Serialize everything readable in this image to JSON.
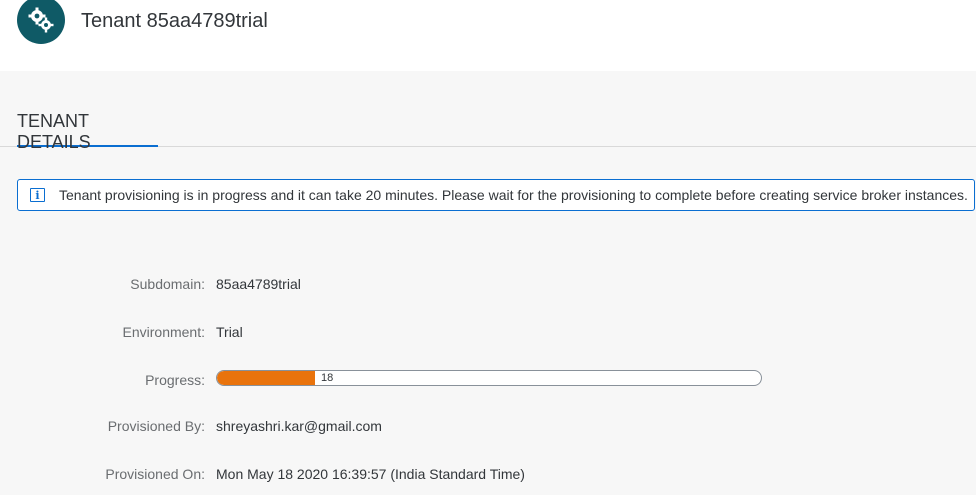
{
  "header": {
    "icon": "gears-icon",
    "title": "Tenant 85aa4789trial",
    "avatar_color": "#0f5a66"
  },
  "tabs": [
    {
      "label": "TENANT DETAILS",
      "selected": true
    }
  ],
  "message": {
    "icon": "info-icon",
    "text": "Tenant provisioning is in progress and it can take 20 minutes. Please wait for the provisioning to complete before creating service broker instances."
  },
  "details": {
    "subdomain": {
      "label": "Subdomain:",
      "value": "85aa4789trial"
    },
    "environment": {
      "label": "Environment:",
      "value": "Trial"
    },
    "progress": {
      "label": "Progress:",
      "value": 18,
      "value_text": "18",
      "max": 100,
      "color": "#e9730c"
    },
    "provisioned_by": {
      "label": "Provisioned By:",
      "value": "shreyashri.kar@gmail.com"
    },
    "provisioned_on": {
      "label": "Provisioned On:",
      "value": "Mon May 18 2020 16:39:57 (India Standard Time)"
    }
  },
  "colors": {
    "accent": "#0a6ed1",
    "background": "#f7f7f7",
    "label_text": "#6a6d70",
    "value_text": "#32363a"
  }
}
